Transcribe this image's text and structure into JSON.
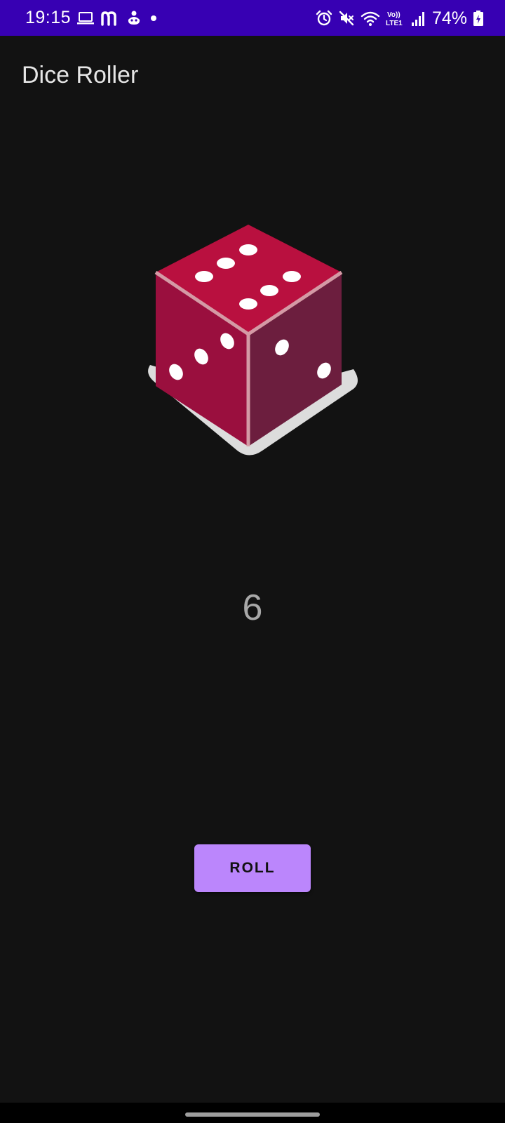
{
  "status_bar": {
    "time": "19:15",
    "battery": "74%",
    "background_color": "#3700B3",
    "left_icons": [
      "laptop-icon",
      "m-notification-icon",
      "game-icon",
      "dot-icon"
    ],
    "right_icons": [
      "alarm-icon",
      "mute-icon",
      "wifi-icon",
      "volte-icon",
      "signal-icon",
      "battery-icon"
    ],
    "volte_label_top": "Vo))",
    "volte_label_bottom": "LTE1"
  },
  "app_bar": {
    "title": "Dice Roller"
  },
  "dice": {
    "image_name": "dice-six-image",
    "top_face_pips": 6,
    "left_face_pips": 3,
    "right_face_pips": 2
  },
  "result": {
    "value": "6"
  },
  "roll_button": {
    "label": "ROLL",
    "color": "#BB86FC"
  },
  "colors": {
    "background": "#121212",
    "dice_top": "#B9103F",
    "dice_left": "#9A0F3E",
    "dice_right": "#6C1E3E",
    "dice_shadow": "#DCDCDC"
  }
}
